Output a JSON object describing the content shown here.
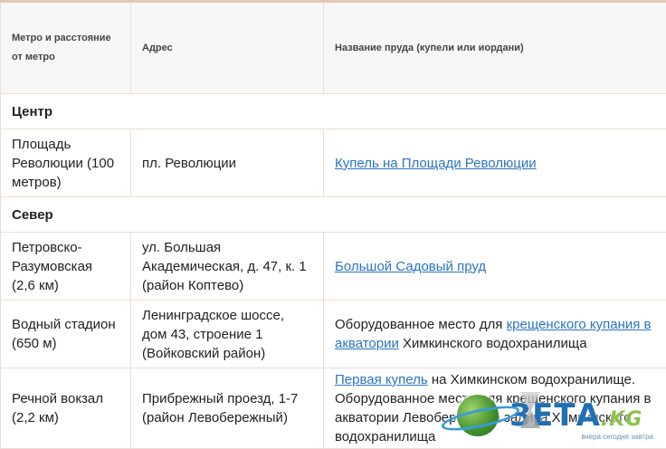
{
  "header": {
    "col1": "Метро и расстояние от метро",
    "col2": "Адрес",
    "col3": "Название пруда (купели или иордани)"
  },
  "sections": {
    "center": "Центр",
    "north": "Север"
  },
  "rows": [
    {
      "metro": "Площадь Революции (100 метров)",
      "address": "пл. Революции",
      "link": "Купель на Площади Революции"
    },
    {
      "metro": "Петровско-Разумовская (2,6 км)",
      "address": "ул. Большая Академическая, д. 47, к. 1 (район Коптево)",
      "link": "Большой Садовый пруд"
    },
    {
      "metro": "Водный стадион (650 м)",
      "address": "Ленинградское шоссе, дом 43, строение 1 (Войковский район)",
      "pre": "Оборудованное место для ",
      "link": "крещенского купания в акватории",
      "post": " Химкинского водохранилища"
    },
    {
      "metro": "Речной вокзал (2,2 км)",
      "address": "Прибрежный проезд, 1-7 (район Левобережный)",
      "link": "Первая купель",
      "post": " на Химкинском водохранилище. Оборудованное место для крещенского купания в акватории Левобережного залива Химкинского водохранилища"
    }
  ],
  "watermark": {
    "logo": "ЗЕТА",
    "suffix": ".KG",
    "tagline": "вчера сегодня завтра"
  }
}
